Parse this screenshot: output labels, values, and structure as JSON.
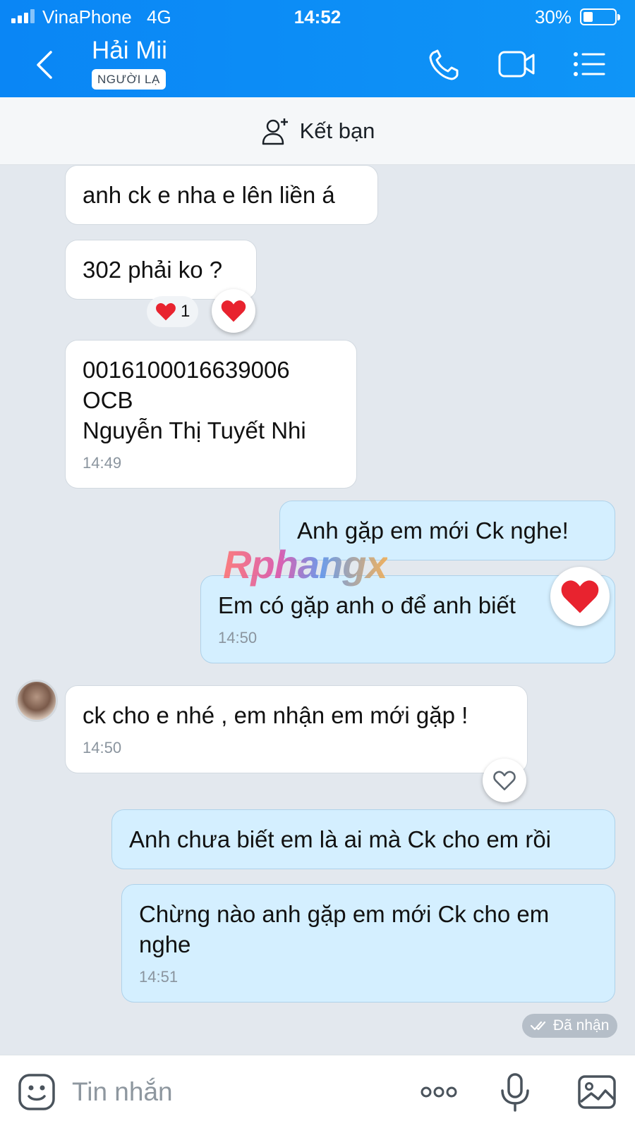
{
  "status_bar": {
    "carrier": "VinaPhone",
    "network": "4G",
    "time": "14:52",
    "battery_percent": "30%",
    "battery_level": 0.3
  },
  "header": {
    "contact_name": "Hải Mii",
    "badge": "NGƯỜI LẠ",
    "icons": [
      "back-icon",
      "phone-icon",
      "video-camera-icon",
      "list-menu-icon"
    ]
  },
  "friend_bar": {
    "label": "Kết bạn",
    "icon": "add-user-icon"
  },
  "messages": [
    {
      "side": "incoming",
      "text": "anh ck e nha e lên liền á"
    },
    {
      "side": "incoming",
      "text": "302 phải ko ?",
      "reaction_count": "1",
      "reaction": "heart"
    },
    {
      "side": "incoming",
      "lines": [
        "0016100016639006",
        "OCB",
        "Nguyễn Thị Tuyết Nhi"
      ],
      "time": "14:49"
    },
    {
      "side": "outgoing",
      "text": "Anh gặp em mới Ck nghe!"
    },
    {
      "side": "outgoing",
      "text": "Em có gặp anh o để anh biết",
      "time": "14:50",
      "reaction": "heart"
    },
    {
      "side": "incoming",
      "text": "ck cho e nhé , em nhận em mới gặp !",
      "time": "14:50",
      "reaction": "heart-outline"
    },
    {
      "side": "outgoing",
      "text": "Anh chưa biết em là ai mà Ck cho em rồi"
    },
    {
      "side": "outgoing",
      "lines": [
        "Chừng nào anh gặp em mới Ck cho em",
        "nghe"
      ],
      "time": "14:51"
    }
  ],
  "watermark": "Rphangx",
  "delivery_status": "Đã nhận",
  "input_bar": {
    "placeholder": "Tin nhắn",
    "icons": [
      "sticker-icon",
      "more-icon",
      "microphone-icon",
      "image-icon"
    ]
  },
  "colors": {
    "header": "#0a86f5",
    "outgoing_bubble": "#d4efff",
    "incoming_bubble": "#ffffff",
    "heart": "#e8232f"
  }
}
